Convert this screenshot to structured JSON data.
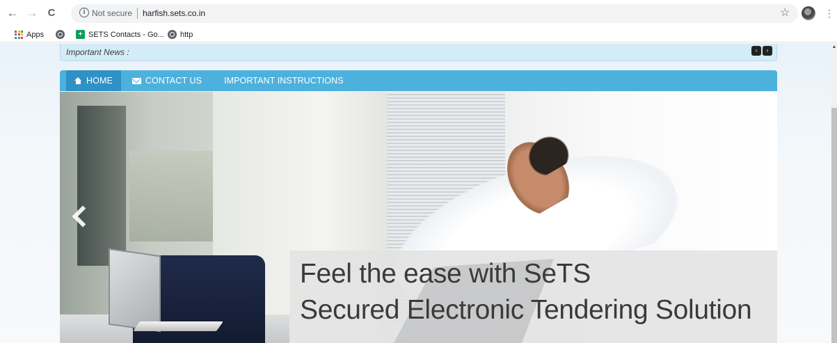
{
  "browser": {
    "back_glyph": "←",
    "forward_glyph": "→",
    "reload_glyph": "C",
    "security_label": "Not secure",
    "url": "harfish.sets.co.in",
    "star_glyph": "☆",
    "menu_glyph": "⋮",
    "bookmarks": [
      {
        "label": "Apps",
        "icon": "apps-grid-icon"
      },
      {
        "label": "",
        "icon": "globe-icon"
      },
      {
        "label": "SETS Contacts - Go...",
        "icon": "sets-contacts-icon"
      },
      {
        "label": "http",
        "icon": "globe-icon"
      }
    ],
    "apps_colors": [
      "#ea4335",
      "#fbbc05",
      "#34a853",
      "#4285f4",
      "#ea4335",
      "#fbbc05",
      "#34a853",
      "#4285f4",
      "#ea4335"
    ]
  },
  "news": {
    "label": "Important News :",
    "prev_glyph": "‹",
    "next_glyph": "›"
  },
  "menu": {
    "items": [
      {
        "label": "HOME",
        "icon": "home-icon",
        "active": true
      },
      {
        "label": "CONTACT US",
        "icon": "mail-icon",
        "active": false
      },
      {
        "label": "IMPORTANT INSTRUCTIONS",
        "icon": "",
        "active": false
      }
    ],
    "bar_color": "#4db1dd",
    "active_color": "#2f91c5"
  },
  "banner": {
    "caption_line1": "Feel the ease with SeTS",
    "caption_line2": "Secured Electronic Tendering Solution",
    "prev_icon": "chevron-left-icon"
  }
}
